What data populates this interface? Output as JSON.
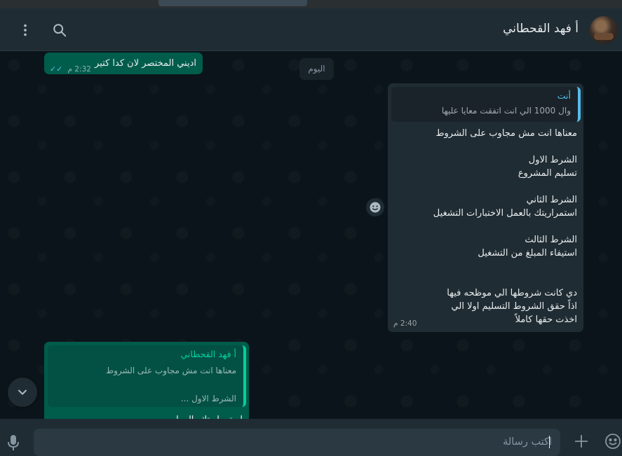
{
  "header": {
    "contact_name": "أ فهد القحطاني"
  },
  "chat": {
    "date_label": "اليوم",
    "messages": [
      {
        "direction": "outgoing",
        "text": "اديني المختصر لان كدا كتير",
        "time": "2:32 م",
        "status": "read"
      },
      {
        "direction": "incoming",
        "quote_author": "أنت",
        "quote_text": "وال 1000 الي انت اتفقت معايا عليها",
        "text": "معناها انت مش مجاوب على الشروط\n\nالشرط الاول\nتسليم المشروع\n\nالشرط الثاني\nاستمراريتك بالعمل الاختبارات التشغيل\n\nالشرط الثالث\nاستيفاء المبلغ من التشغيل\n\n\nدي كانت شروطها الي موظحه فيها\nاذاً حقق الشروط التسليم اولا الي\nاخذت حقها كاملاً",
        "time": "2:40 م"
      },
      {
        "direction": "outgoing",
        "quote_author": "أ فهد القحطاني",
        "quote_text": "معناها انت  مش مجاوب على الشروط\n\nالشرط الاول ...",
        "text_partial": "استمراريتك بالعمل"
      }
    ]
  },
  "composer": {
    "placeholder": "اكتب رسالة"
  },
  "colors": {
    "header_bg": "#202c33",
    "chat_bg": "#0b141a",
    "outgoing_bubble": "#005c4b",
    "incoming_bubble": "#202c33",
    "accent_green": "#06cf9c",
    "accent_blue": "#53bdeb"
  },
  "icons": {
    "menu": "kebab-menu-icon",
    "search": "search-icon",
    "emoji": "smiley-icon",
    "attach": "plus-icon",
    "mic": "microphone-icon",
    "scroll": "chevron-down-icon"
  }
}
